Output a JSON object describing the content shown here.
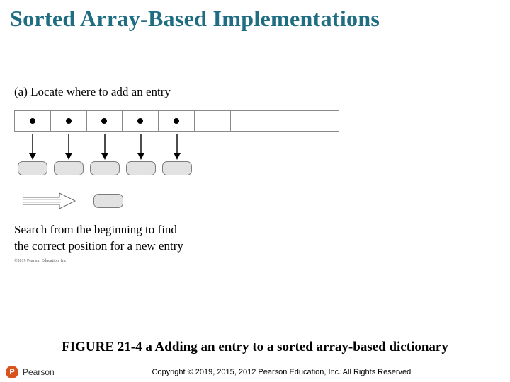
{
  "title": "Sorted Array-Based Implementations",
  "figure": {
    "part_label": "(a) Locate where to add an entry",
    "array": {
      "total_cells": 9,
      "filled_cells": 5
    },
    "insert_pill_index": 2,
    "explain_line1": "Search from the beginning to find",
    "explain_line2": "the correct position for a new entry",
    "fine_print": "©2019 Pearson Education, Inc.",
    "caption": "FIGURE 21-4 a Adding an entry to a sorted array-based dictionary"
  },
  "footer": {
    "brand_initial": "P",
    "brand_name": "Pearson",
    "copyright": "Copyright © 2019, 2015, 2012 Pearson Education, Inc. All Rights Reserved"
  }
}
